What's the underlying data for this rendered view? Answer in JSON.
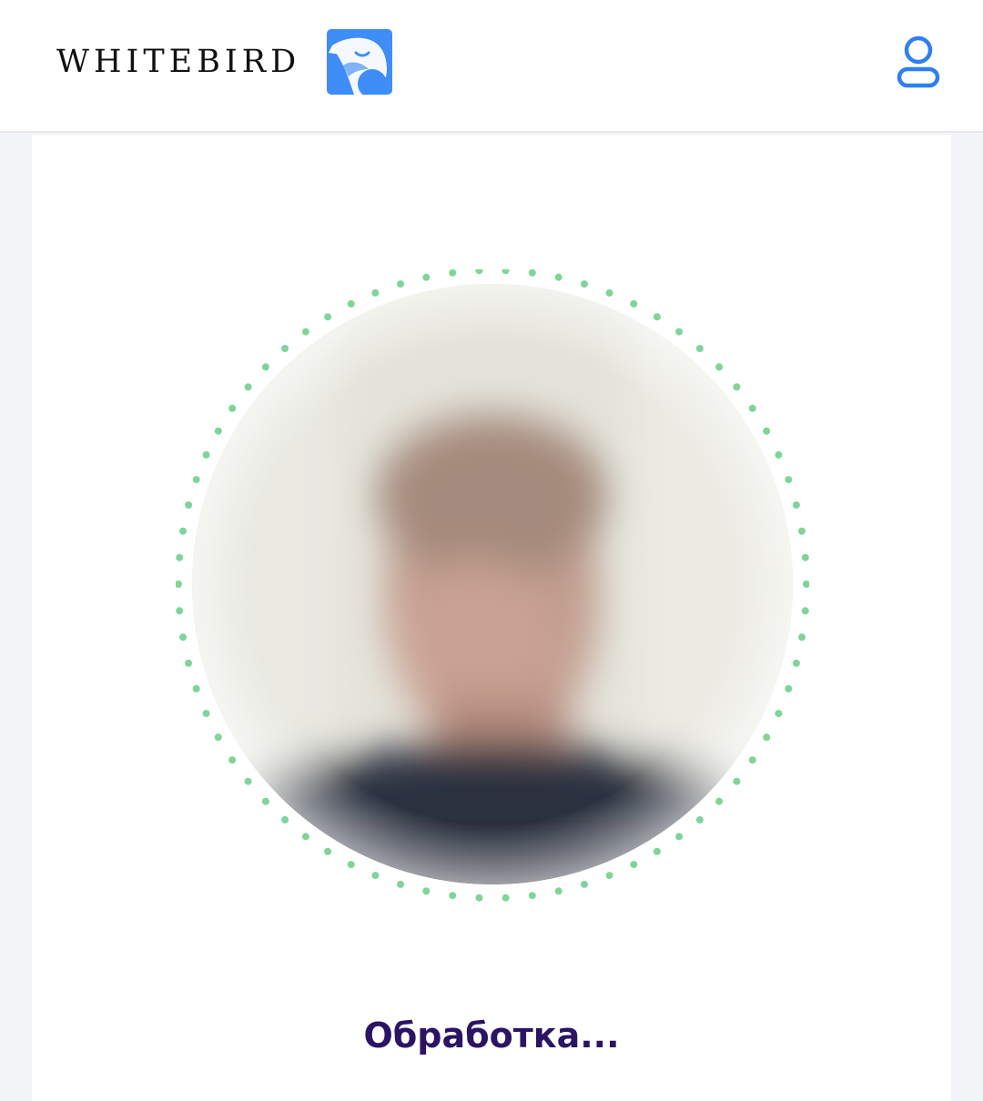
{
  "header": {
    "brand_name": "WHITEBIRD",
    "logo_icon": "bird-logo-icon",
    "profile_icon": "user-profile-icon",
    "accent_color": "#3f8df6"
  },
  "scanner": {
    "face_preview": "blurred-face-camera-preview",
    "ring_color": "#7fd49a",
    "status_text": "Обработка..."
  }
}
